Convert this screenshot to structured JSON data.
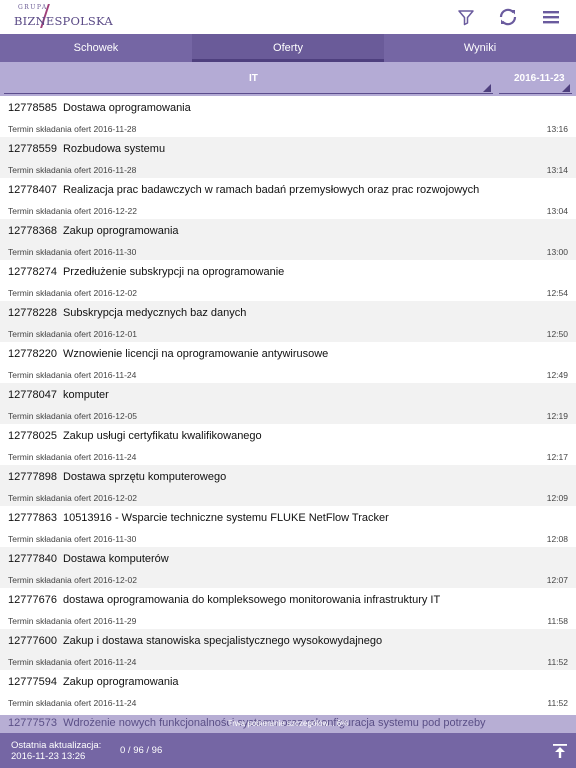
{
  "header": {
    "logo_small": "GRUPA",
    "logo_big": "BIZNESPOLSKA",
    "icons": [
      "filter-icon",
      "refresh-icon",
      "menu-icon"
    ]
  },
  "tabs": [
    {
      "label": "Schowek"
    },
    {
      "label": "Oferty",
      "active": true
    },
    {
      "label": "Wyniki"
    }
  ],
  "filters": {
    "category": "IT",
    "date": "2016-11-23"
  },
  "tenders": [
    {
      "id": "12778585",
      "title": "Dostawa oprogramowania",
      "deadline": "Termin składania ofert 2016-11-28",
      "time": "13:16"
    },
    {
      "id": "12778559",
      "title": "Rozbudowa systemu",
      "deadline": "Termin składania ofert 2016-11-28",
      "time": "13:14"
    },
    {
      "id": "12778407",
      "title": "Realizacja prac badawczych w ramach badań przemysłowych oraz prac rozwojowych",
      "deadline": "Termin składania ofert 2016-12-22",
      "time": "13:04"
    },
    {
      "id": "12778368",
      "title": "Zakup oprogramowania",
      "deadline": "Termin składania ofert 2016-11-30",
      "time": "13:00"
    },
    {
      "id": "12778274",
      "title": "Przedłużenie subskrypcji na oprogramowanie",
      "deadline": "Termin składania ofert 2016-12-02",
      "time": "12:54"
    },
    {
      "id": "12778228",
      "title": "Subskrypcja medycznych baz danych",
      "deadline": "Termin składania ofert 2016-12-01",
      "time": "12:50"
    },
    {
      "id": "12778220",
      "title": "Wznowienie licencji na oprogramowanie antywirusowe",
      "deadline": "Termin składania ofert 2016-11-24",
      "time": "12:49"
    },
    {
      "id": "12778047",
      "title": "komputer",
      "deadline": "Termin składania ofert 2016-12-05",
      "time": "12:19"
    },
    {
      "id": "12778025",
      "title": "Zakup usługi certyfikatu kwalifikowanego",
      "deadline": "Termin składania ofert 2016-11-24",
      "time": "12:17"
    },
    {
      "id": "12777898",
      "title": "Dostawa sprzętu komputerowego",
      "deadline": "Termin składania ofert 2016-12-02",
      "time": "12:09"
    },
    {
      "id": "12777863",
      "title": "10513916 - Wsparcie techniczne systemu FLUKE NetFlow Tracker",
      "deadline": "Termin składania ofert 2016-11-30",
      "time": "12:08"
    },
    {
      "id": "12777840",
      "title": "Dostawa komputerów",
      "deadline": "Termin składania ofert 2016-12-02",
      "time": "12:07"
    },
    {
      "id": "12777676",
      "title": "dostawa oprogramowania do kompleksowego monitorowania infrastruktury IT",
      "deadline": "Termin składania ofert 2016-11-29",
      "time": "11:58"
    },
    {
      "id": "12777600",
      "title": "Zakup i dostawa stanowiska specjalistycznego wysokowydajnego",
      "deadline": "Termin składania ofert 2016-11-24",
      "time": "11:52"
    },
    {
      "id": "12777594",
      "title": "Zakup oprogramowania",
      "deadline": "Termin składania ofert 2016-11-24",
      "time": "11:52"
    }
  ],
  "partial_row": {
    "id": "12777573",
    "title": "Wdrożenie nowych funkcjonalności systemu oraz rekonfiguracja systemu pod potrzeby"
  },
  "loading_text": "Trwa pobieranie szczegółów... 6%",
  "footer": {
    "update_label": "Ostatnia aktualizacja:",
    "update_value": "2016-11-23 13:26",
    "count": "0 / 96 / 96"
  }
}
